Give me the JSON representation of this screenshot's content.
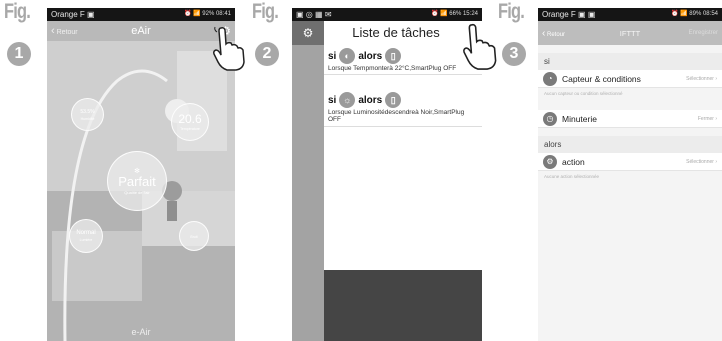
{
  "figures": [
    {
      "label": "Fig.",
      "number": "1"
    },
    {
      "label": "Fig.",
      "number": "2"
    },
    {
      "label": "Fig.",
      "number": "3"
    }
  ],
  "phone1": {
    "status": {
      "carrier": "Orange F",
      "right": "92% 08:41"
    },
    "header": {
      "back": "Retour",
      "title": "eAir",
      "settings_icon": "gear-icon"
    },
    "humidity": {
      "value": "53.5%",
      "label": "Humidité"
    },
    "temperature": {
      "value": "20.6",
      "label": "Température"
    },
    "air_quality": {
      "value": "Parfait",
      "label": "Qualité de l'air"
    },
    "light": {
      "value": "Normal",
      "label": "Lumière"
    },
    "bruit": {
      "value": "",
      "label": "Bruit"
    },
    "brand": "e-Air"
  },
  "phone2": {
    "status": {
      "right": "66% 15:24"
    },
    "header": {
      "title": "Liste de tâches",
      "settings_icon": "gear-icon"
    },
    "tasks": [
      {
        "si": "si",
        "alors": "alors",
        "description": "Lorsque Tempmonterà 22°C,SmartPlug OFF"
      },
      {
        "si": "si",
        "alors": "alors",
        "description": "Lorsque Luminositédescendreà Noir,SmartPlug OFF"
      }
    ]
  },
  "phone3": {
    "status": {
      "carrier": "Orange F",
      "right": "89% 08:54"
    },
    "header": {
      "back": "Retour",
      "title": "IFTTT",
      "save": "Enregistrer"
    },
    "si_label": "si",
    "sensor_row": {
      "label": "Capteur & conditions",
      "action": "Sélectionner"
    },
    "sensor_note": "Aucun capteur ou condition sélectionné",
    "timer_row": {
      "label": "Minuterie",
      "action": "Fermer"
    },
    "alors_label": "alors",
    "action_row": {
      "label": "action",
      "action": "Sélectionner"
    },
    "action_note": "Aucune action sélectionnée"
  },
  "colors": {
    "fig_gray": "#a8a8a8",
    "statusbar": "#151515",
    "p3_header": "#bdbdbd",
    "p2_bottom": "#454545"
  }
}
